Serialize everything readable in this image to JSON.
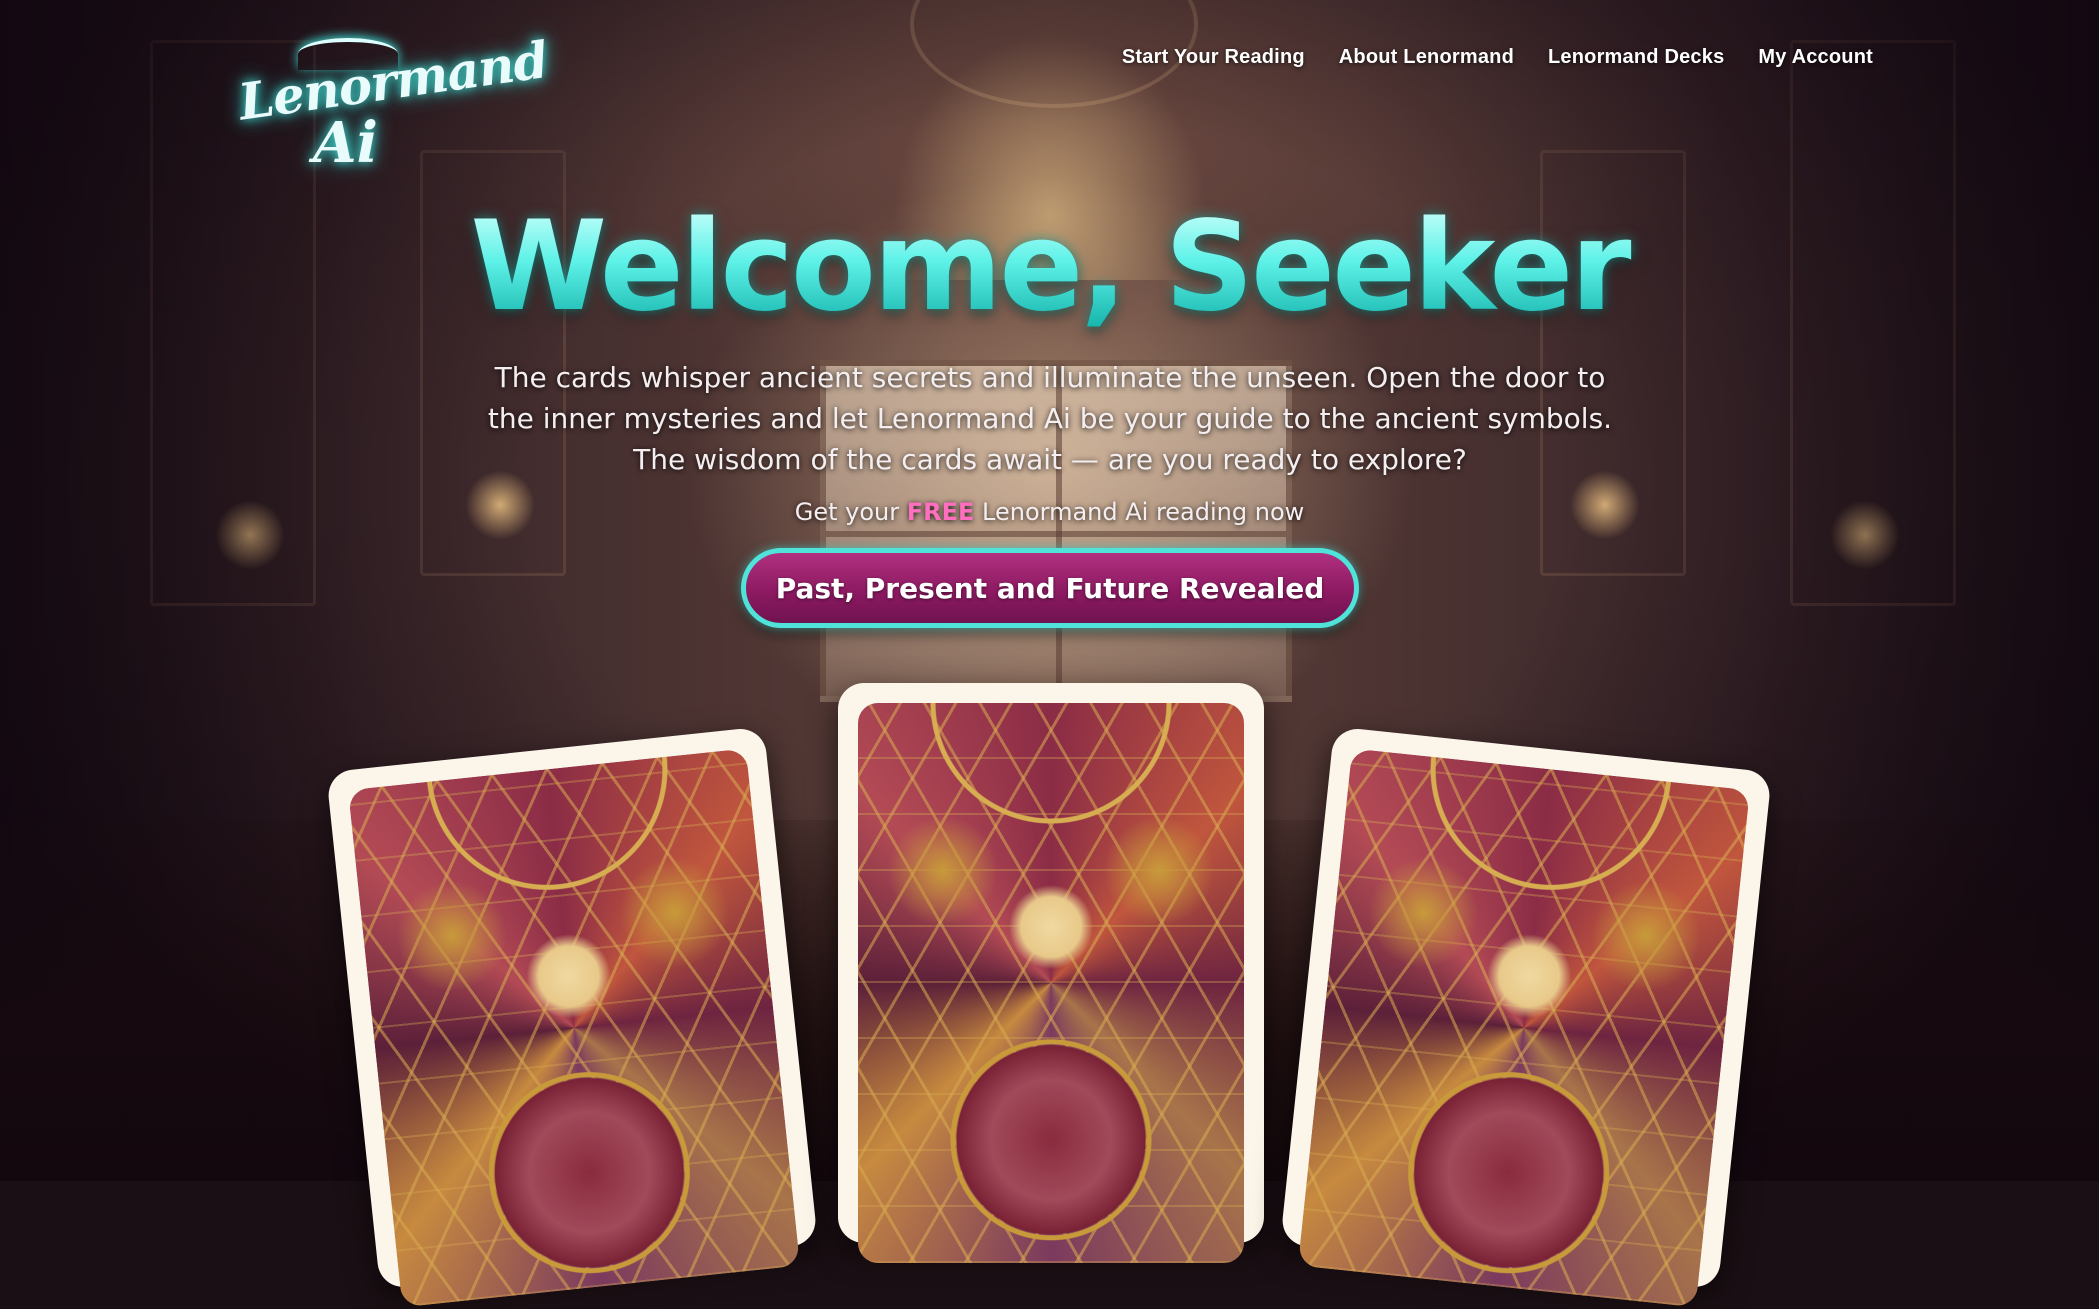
{
  "logo": {
    "line1": "Lenormand",
    "line2": "Ai"
  },
  "nav": {
    "items": [
      {
        "label": "Start Your Reading"
      },
      {
        "label": "About Lenormand"
      },
      {
        "label": "Lenormand Decks"
      },
      {
        "label": "My Account"
      }
    ]
  },
  "hero": {
    "title": "Welcome, Seeker",
    "description": "The cards whisper ancient secrets and illuminate the unseen. Open the door to the inner mysteries and let Lenormand Ai be your guide to the ancient symbols. The wisdom of the cards await — are you ready to explore?",
    "free_prefix": "Get your ",
    "free_word": "FREE",
    "free_suffix": " Lenormand Ai reading now",
    "cta_label": "Past, Present and Future Revealed"
  },
  "colors": {
    "title_gradient_top": "#c9fffb",
    "title_gradient_bottom": "#14b3ab",
    "accent_free": "#ff6fbf",
    "cta_fill": "#8d1a62",
    "cta_border": "#4fe3da",
    "card_border": "#fbf5ea"
  },
  "cards": [
    {
      "icon": "sacred-geometry-card-back"
    },
    {
      "icon": "sacred-geometry-card-back"
    },
    {
      "icon": "sacred-geometry-card-back"
    }
  ]
}
